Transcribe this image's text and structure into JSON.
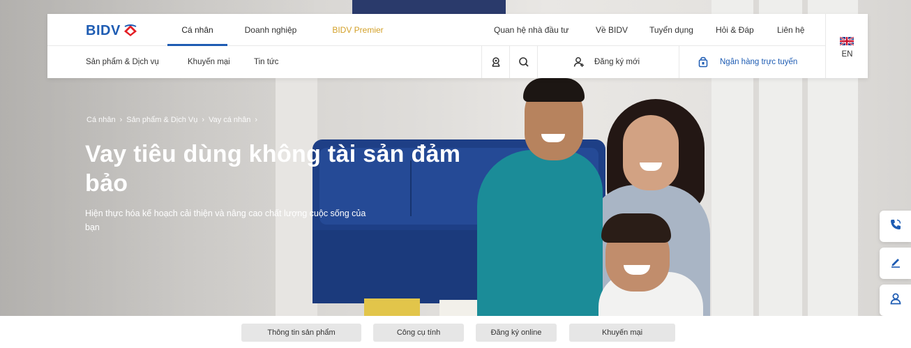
{
  "brand": {
    "name": "BIDV",
    "primary_color": "#1e5cb3",
    "accent_color": "#e31e24",
    "premium_color": "#d3a028"
  },
  "header": {
    "tabs": [
      {
        "label": "Cá nhân",
        "active": true
      },
      {
        "label": "Doanh nghiệp",
        "active": false
      },
      {
        "label": "BIDV Premier",
        "active": false
      }
    ],
    "top_links": [
      "Quan hệ nhà đầu tư",
      "Về BIDV",
      "Tuyển dụng",
      "Hỏi & Đáp",
      "Liên hệ"
    ],
    "sub_links": [
      "Sản phẩm & Dịch vụ",
      "Khuyến mại",
      "Tin tức"
    ],
    "icons": [
      "branch-locator-icon",
      "search-icon",
      "user-add-icon"
    ],
    "register_label": "Đăng ký mới",
    "ebank_label": "Ngân hàng trực tuyến",
    "language": {
      "label": "EN",
      "flag": "uk-flag-icon"
    }
  },
  "hero": {
    "breadcrumb": [
      "Cá nhân",
      "Sản phẩm & Dịch Vụ",
      "Vay cá nhân"
    ],
    "title": "Vay tiêu dùng không tài sản đảm bảo",
    "subtitle": "Hiện thực hóa kế hoạch cải thiện và nâng cao chất lượng cuộc sống của bạn"
  },
  "side_buttons": [
    "phone-icon",
    "edit-icon",
    "user-icon"
  ],
  "bottom_tabs": [
    "Thông tin sản phẩm",
    "Công cụ tính",
    "Đăng ký online",
    "Khuyến mại"
  ]
}
